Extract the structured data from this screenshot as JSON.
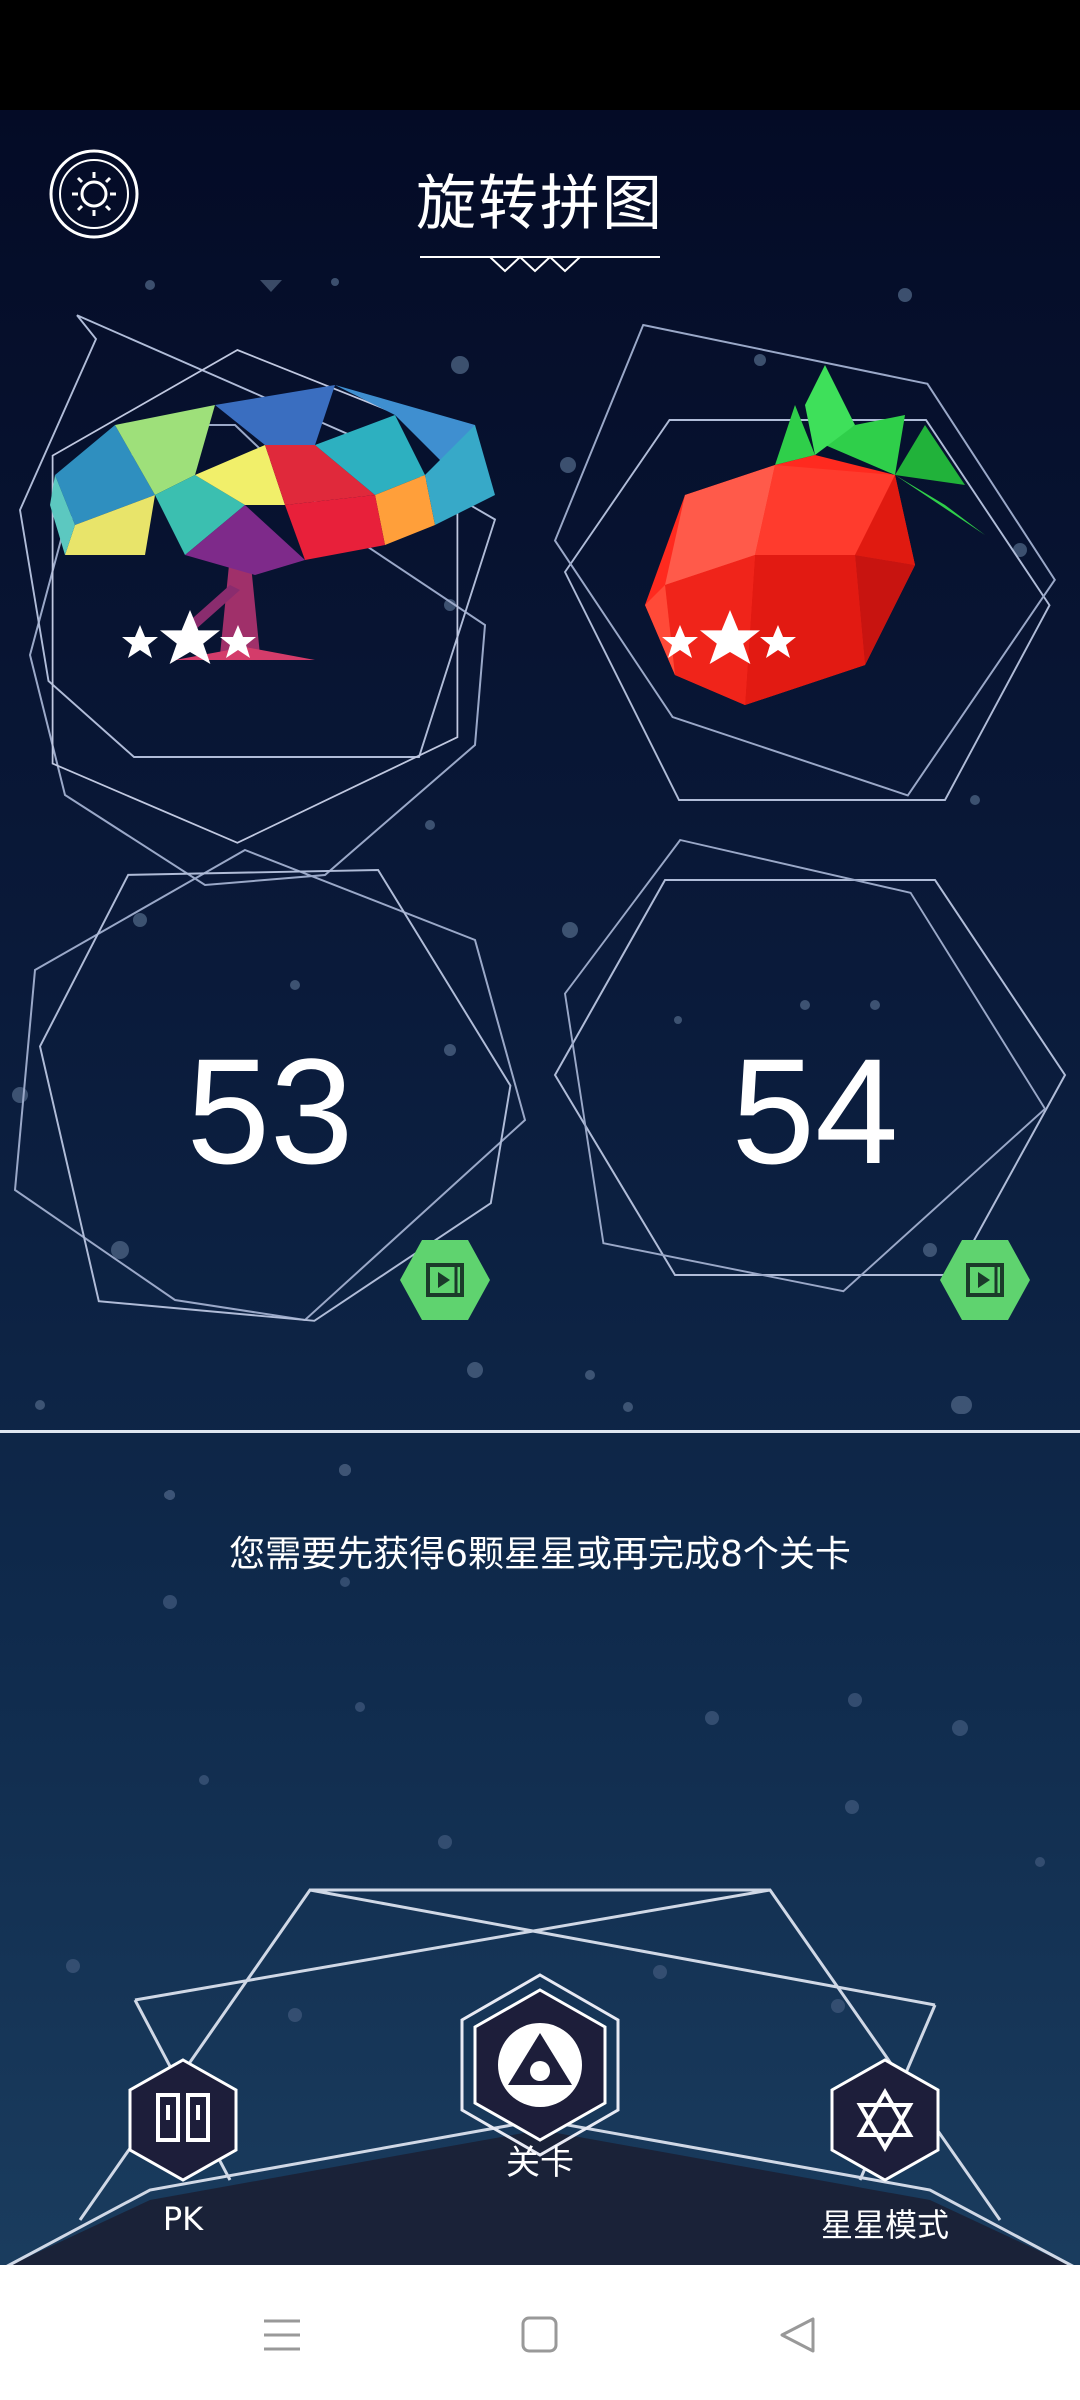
{
  "header": {
    "title": "旋转拼图"
  },
  "levels": [
    {
      "kind": "image",
      "image": "tree",
      "stars": 3,
      "stars_max": 3
    },
    {
      "kind": "image",
      "image": "strawberry",
      "stars": 3,
      "stars_max": 3
    },
    {
      "kind": "locked",
      "number": "53",
      "badge_icon": "video-ad-icon"
    },
    {
      "kind": "locked",
      "number": "54",
      "badge_icon": "video-ad-icon"
    }
  ],
  "message": "您需要先获得6颗星星或再完成8个关卡",
  "bottom_nav": {
    "pk_label": "PK",
    "levels_label": "关卡",
    "star_mode_label": "星星模式"
  },
  "colors": {
    "badge": "#5fd36f",
    "background_top": "#040b26",
    "background_bottom": "#1a3c5e"
  }
}
